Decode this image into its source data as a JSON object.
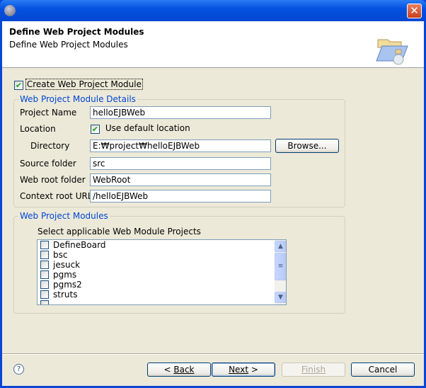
{
  "window": {
    "title": "",
    "close_glyph": "✕"
  },
  "header": {
    "title": "Define Web Project Modules",
    "subtitle": "Define Web Project Modules",
    "icon": "folder-jar-icon"
  },
  "create_module": {
    "label": "Create Web Project Module",
    "checked": true
  },
  "details": {
    "legend": "Web Project Module Details",
    "project_name_label": "Project Name",
    "project_name": "helloEJBWeb",
    "location_label": "Location",
    "use_default_label": "Use default location",
    "use_default_checked": true,
    "directory_label": "Directory",
    "directory": "E:₩project₩helloEJBWeb",
    "browse_label": "Browse...",
    "source_folder_label": "Source folder",
    "source_folder": "src",
    "web_root_label": "Web root folder",
    "web_root": "WebRoot",
    "context_root_label": "Context root URL",
    "context_root": "/helloEJBWeb"
  },
  "modules": {
    "legend": "Web Project Modules",
    "instruction": "Select applicable Web Module Projects",
    "items": [
      {
        "label": "DefineBoard",
        "checked": false
      },
      {
        "label": "bsc",
        "checked": false
      },
      {
        "label": "jesuck",
        "checked": false
      },
      {
        "label": "pgms",
        "checked": false
      },
      {
        "label": "pgms2",
        "checked": false
      },
      {
        "label": "struts",
        "checked": false
      }
    ]
  },
  "footer": {
    "back": "Back",
    "next": "Next",
    "finish": "Finish",
    "cancel": "Cancel",
    "help_glyph": "?"
  }
}
